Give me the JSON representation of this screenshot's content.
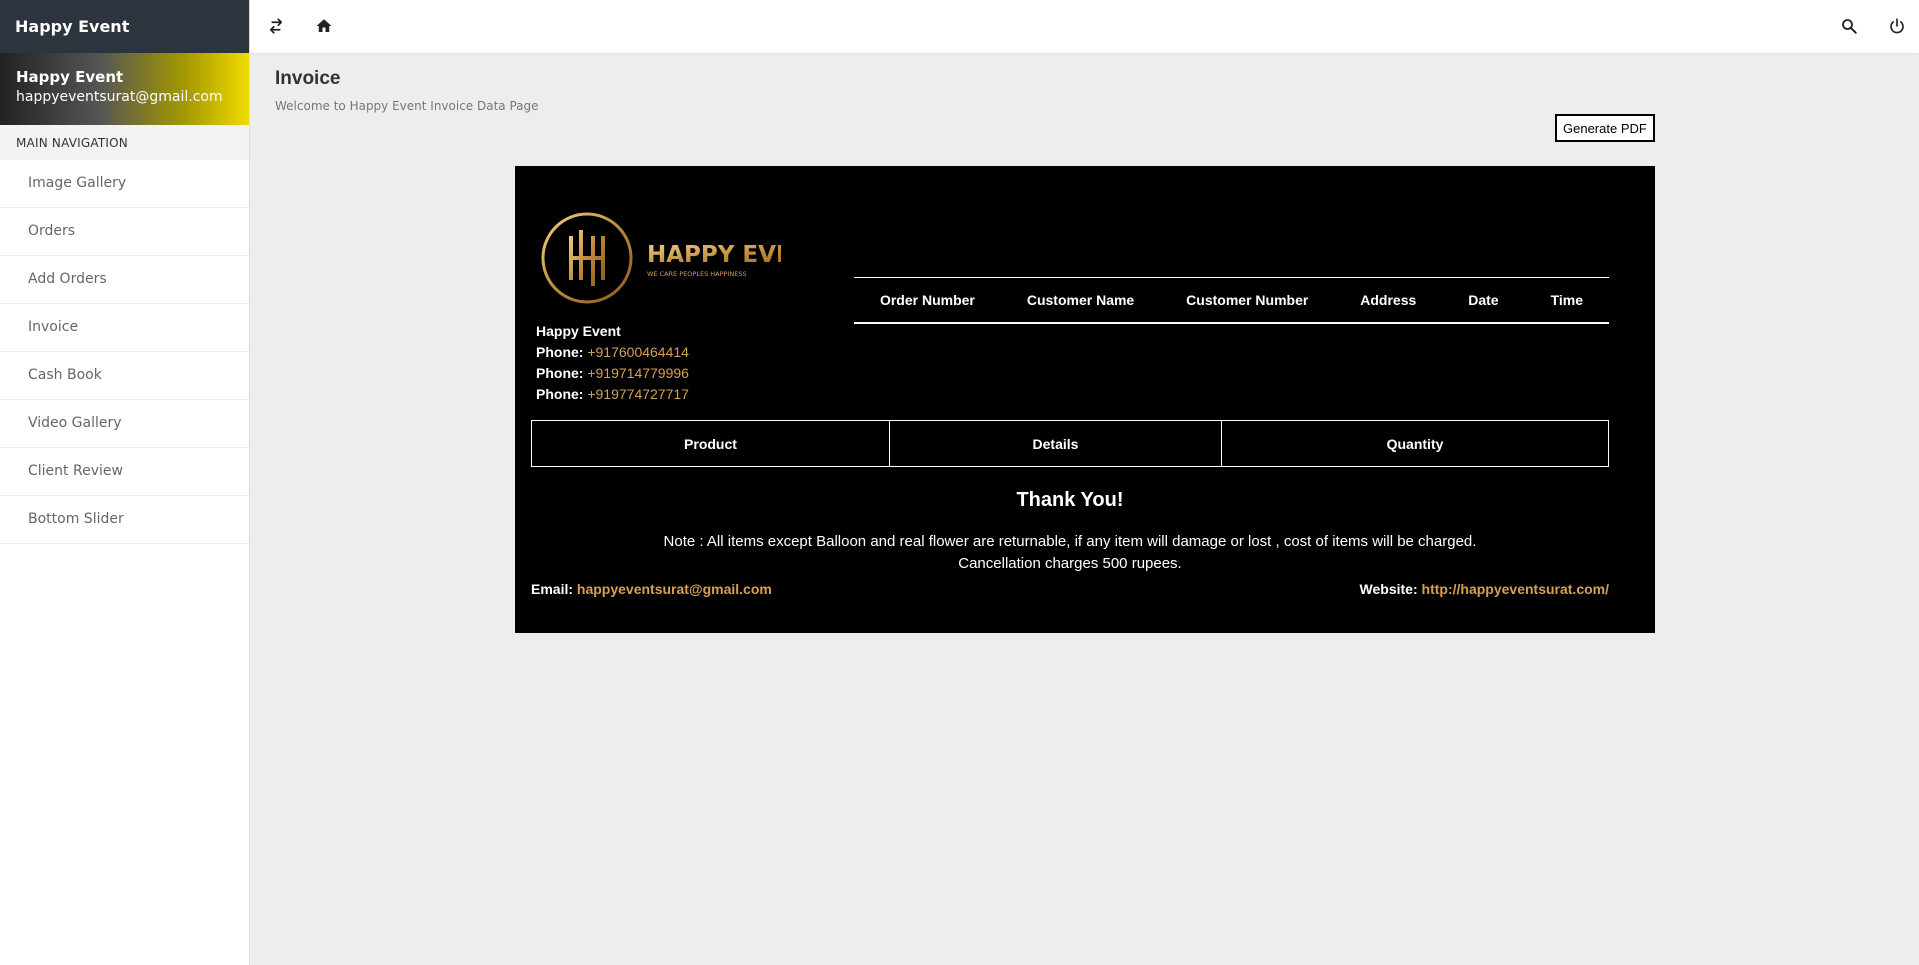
{
  "brand": {
    "name": "Happy Event"
  },
  "user": {
    "name": "Happy Event",
    "email": "happyeventsurat@gmail.com"
  },
  "nav": {
    "header": "MAIN NAVIGATION",
    "items": [
      {
        "label": "Image Gallery"
      },
      {
        "label": "Orders"
      },
      {
        "label": "Add Orders"
      },
      {
        "label": "Invoice"
      },
      {
        "label": "Cash Book"
      },
      {
        "label": "Video Gallery"
      },
      {
        "label": "Client Review"
      },
      {
        "label": "Bottom Slider"
      }
    ]
  },
  "topbar": {
    "icons": [
      "swap-icon",
      "home-icon",
      "search-icon",
      "power-icon"
    ]
  },
  "page": {
    "title": "Invoice",
    "subtitle": "Welcome to Happy Event Invoice Data Page",
    "pdf_button": "Generate PDF"
  },
  "invoice": {
    "logo": {
      "title": "HAPPY EVENTS",
      "tagline": "WE CARE PEOPLES HAPPINESS",
      "monogram": "H"
    },
    "company": {
      "name": "Happy Event",
      "phone_label": "Phone:",
      "phones": [
        "+917600464414",
        "+919714779996",
        "+919774727717"
      ]
    },
    "order_columns": [
      "Order Number",
      "Customer Name",
      "Customer Number",
      "Address",
      "Date",
      "Time"
    ],
    "product_columns": [
      "Product",
      "Details",
      "Quantity"
    ],
    "thanks": "Thank You!",
    "note_line1": "Note : All items except Balloon and real flower are returnable, if any item will damage or lost , cost of items will be charged.",
    "note_line2": "Cancellation charges 500 rupees.",
    "email_label": "Email:",
    "email": "happyeventsurat@gmail.com",
    "website_label": "Website:",
    "website": "http://happyeventsurat.com/"
  },
  "colors": {
    "sidebar_brand_bg": "#2c353d",
    "accent_gold": "#d4a055",
    "invoice_bg": "#000000",
    "user_gradient_end": "#f1dc00"
  }
}
